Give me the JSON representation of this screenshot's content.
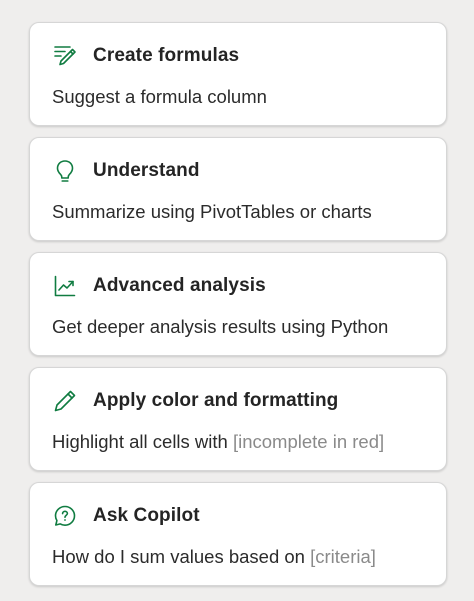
{
  "accent_color": "#107c41",
  "cards": [
    {
      "icon": "formula-pencil-icon",
      "title": "Create formulas",
      "description": "Suggest a formula column",
      "placeholder": ""
    },
    {
      "icon": "lightbulb-icon",
      "title": "Understand",
      "description": "Summarize using PivotTables or charts",
      "placeholder": ""
    },
    {
      "icon": "trend-chart-icon",
      "title": "Advanced analysis",
      "description": "Get deeper analysis results using Python",
      "placeholder": ""
    },
    {
      "icon": "pencil-icon",
      "title": "Apply color and formatting",
      "description": "Highlight all cells with ",
      "placeholder": "[incomplete in red]"
    },
    {
      "icon": "question-chat-icon",
      "title": "Ask Copilot",
      "description": "How do I sum values based on ",
      "placeholder": "[criteria]"
    }
  ]
}
